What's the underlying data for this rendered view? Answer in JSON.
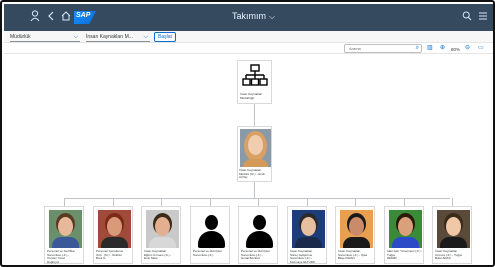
{
  "shell": {
    "title": "Takımım",
    "title_caret": "⌵",
    "logo_text": "SAP",
    "icons": [
      "user-icon",
      "back-icon",
      "home-icon",
      "search-icon",
      "menu-icon"
    ]
  },
  "filters": {
    "select1": "Müdürlük",
    "select2": "İnsan Kaynakları M...",
    "go_button": "Başlat"
  },
  "toolbar": {
    "search_placeholder": "Arama",
    "zoom": "80%"
  },
  "org": {
    "root": {
      "caption_lines": [
        "İnsan Kaynakları",
        "Müdürlüğü"
      ]
    },
    "manager": {
      "caption_lines": [
        "İnsan Kaynakları",
        "Müdürü (Sr.) - Ersin",
        "Al Pay"
      ]
    },
    "children": [
      {
        "caption_lines": [
          "Personel ve Sertifika",
          "Sorumlusu (Jr.) -",
          "Osman Yücel",
          "Doğruyol"
        ],
        "type": "photo",
        "skin": "#e8b89a",
        "hair": "#5a3a22",
        "bg": "#6b8e6b",
        "shirt": "#3b5998"
      },
      {
        "caption_lines": [
          "Personel Genelleme",
          "Uzm. (Sr.) - İbrahim",
          "Bora G."
        ],
        "type": "photo",
        "skin": "#d99a7a",
        "hair": "#7a2a16",
        "bg": "#a04a3a",
        "shirt": "#2a2a2a"
      },
      {
        "caption_lines": [
          "İnsan Kaynakları",
          "Eğitim Uzmanı (Jr.) -",
          "Emir Mete"
        ],
        "type": "photo",
        "skin": "#e2b090",
        "hair": "#3a2a1a",
        "bg": "#c9c9c9",
        "shirt": "#d8d8d8"
      },
      {
        "caption_lines": [
          "Personel ve İdari İşler",
          "Sorumlusu (Jr.)"
        ],
        "type": "silhouette"
      },
      {
        "caption_lines": [
          "Personel ve İdari İşler",
          "Sorumlusu (Jr.) -",
          "İsmail Bozkurt"
        ],
        "type": "silhouette"
      },
      {
        "caption_lines": [
          "İnsan Kaynakları",
          "Süreç Geliştirme",
          "Sorumlusu (Jr.) -",
          "Kazmaye ELTURK"
        ],
        "type": "photo",
        "skin": "#e6bea0",
        "hair": "#2a2a2a",
        "bg": "#1c3d7a",
        "shirt": "#1a2a4a"
      },
      {
        "caption_lines": [
          "İnsan Kaynakları",
          "Sorumlusu (Jr.) - Ilyas",
          "Bilge KIRAN"
        ],
        "type": "photo",
        "skin": "#c98b6a",
        "hair": "#1a1a1a",
        "bg": "#e8a050",
        "shirt": "#1a1a1a"
      },
      {
        "caption_lines": [
          "İdari İşler Yönetmeni (Jr.) -",
          "Tuğçe",
          "DEMİR"
        ],
        "type": "photo",
        "skin": "#d9a07a",
        "hair": "#2a1a0a",
        "bg": "#3a8a3a",
        "shirt": "#2a4ac8"
      },
      {
        "caption_lines": [
          "İnsan Kaynakları",
          "Uzmanı (Jr.) - Tuğçe",
          "Bulut ARAS"
        ],
        "type": "photo",
        "skin": "#f0c8a8",
        "hair": "#3a2a1a",
        "bg": "#5a4a3a",
        "shirt": "#1a1a1a"
      }
    ]
  },
  "colors": {
    "shell_bg": "#354a5f",
    "accent": "#0a6ed1",
    "line": "#c0c4c8"
  }
}
